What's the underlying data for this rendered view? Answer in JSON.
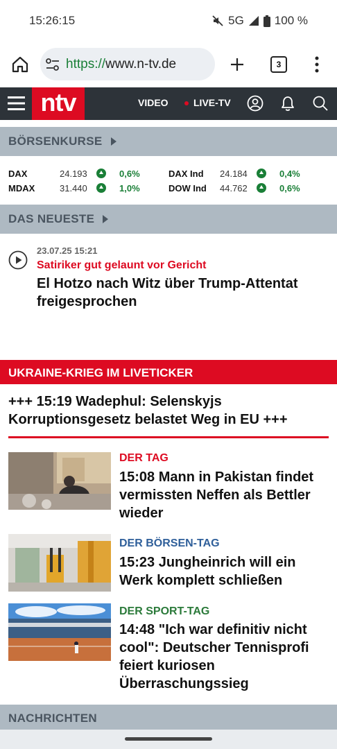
{
  "status": {
    "time": "15:26:15",
    "network": "5G",
    "battery": "100 %"
  },
  "browser": {
    "url_scheme": "https://",
    "url_host": "www.n-tv.de",
    "tab_count": "3"
  },
  "nav": {
    "logo": "ntv",
    "video": "VIDEO",
    "livetv": "LIVE-TV"
  },
  "boersenkurse": {
    "title": "BÖRSENKURSE",
    "items": [
      {
        "name": "DAX",
        "value": "24.193",
        "change": "0,6%"
      },
      {
        "name": "MDAX",
        "value": "31.440",
        "change": "1,0%"
      },
      {
        "name": "DAX Ind",
        "value": "24.184",
        "change": "0,4%"
      },
      {
        "name": "DOW Ind",
        "value": "44.762",
        "change": "0,6%"
      }
    ]
  },
  "neueste": {
    "title": "DAS NEUESTE",
    "timestamp": "23.07.25 15:21",
    "kicker": "Satiriker gut gelaunt vor Gericht",
    "headline_line1": "El Hotzo nach Witz über Trump-Attentat",
    "headline_line2": "freigesprochen"
  },
  "ukraine": {
    "title": "UKRAINE-KRIEG IM LIVETICKER",
    "headline_line1": "+++ 15:19 Wadephul: Selenskyjs",
    "headline_line2": "Korruptionsgesetz belastet Weg in EU +++"
  },
  "articles": [
    {
      "kicker": "DER TAG",
      "kicker_color": "#dd0b22",
      "lines": [
        "15:08 Mann in Pakistan findet",
        "vermissten Neffen als Bettler",
        "wieder"
      ]
    },
    {
      "kicker": "DER BÖRSEN-TAG",
      "kicker_color": "#2f5f9a",
      "lines": [
        "15:23 Jungheinrich will ein",
        "Werk komplett schließen"
      ]
    },
    {
      "kicker": "DER SPORT-TAG",
      "kicker_color": "#2b7a3a",
      "lines": [
        "14:48 \"Ich war definitiv nicht",
        "cool\": Deutscher Tennisprofi",
        "feiert kuriosen",
        "Überraschungssieg"
      ]
    }
  ],
  "nachrichten": {
    "title": "NACHRICHTEN"
  },
  "colors": {
    "brand_red": "#dd0b22",
    "nav_dark": "#2d3339",
    "section_grey": "#aeb9c2",
    "positive_green": "#1a7f37"
  }
}
